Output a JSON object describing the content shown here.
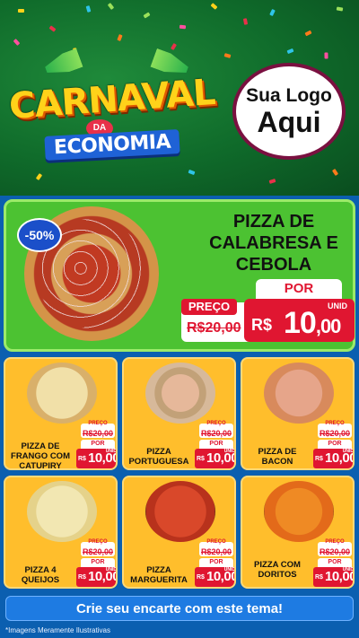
{
  "header": {
    "brand_line1": "Sua Logo",
    "brand_line2": "Aqui",
    "title_carnaval": "CARNAVAL",
    "title_da": "DA",
    "title_economia": "ECONOMIA"
  },
  "featured": {
    "badge": "-50%",
    "name": "PIZZA DE CALABRESA E CEBOLA",
    "preco_label": "PREÇO",
    "old_price": "R$20,00",
    "por_label": "POR",
    "unid_label": "UNID",
    "currency": "R$",
    "price_int": "10",
    "price_dec": ",00"
  },
  "products": [
    {
      "name": "PIZZA DE FRANGO COM CATUPIRY",
      "preco_label": "PREÇO",
      "old_price": "R$20,00",
      "por_label": "POR",
      "currency": "R$",
      "price": "10,00",
      "unid": "UNID"
    },
    {
      "name": "PIZZA PORTUGUESA",
      "preco_label": "PREÇO",
      "old_price": "R$20,00",
      "por_label": "POR",
      "currency": "R$",
      "price": "10,00",
      "unid": "UNID"
    },
    {
      "name": "PIZZA DE BACON",
      "preco_label": "PREÇO",
      "old_price": "R$20,00",
      "por_label": "POR",
      "currency": "R$",
      "price": "10,00",
      "unid": "UNID"
    },
    {
      "name": "PIZZA 4 QUEIJOS",
      "preco_label": "PREÇO",
      "old_price": "R$20,00",
      "por_label": "POR",
      "currency": "R$",
      "price": "10,00",
      "unid": "UNID"
    },
    {
      "name": "PIZZA MARGUERITA",
      "preco_label": "PREÇO",
      "old_price": "R$20,00",
      "por_label": "POR",
      "currency": "R$",
      "price": "10,00",
      "unid": "UNID"
    },
    {
      "name": "PIZZA COM DORITOS",
      "preco_label": "PREÇO",
      "old_price": "R$20,00",
      "por_label": "POR",
      "currency": "R$",
      "price": "10,00",
      "unid": "UNID"
    }
  ],
  "cta": {
    "label": "Crie seu encarte com este tema!"
  },
  "disclaimer": "*Imagens Meramente Ilustrativas",
  "colors": {
    "accent_red": "#e01631",
    "card_yellow": "#ffbe2c",
    "featured_green": "#4cc232",
    "page_blue": "#0b5fb0"
  }
}
